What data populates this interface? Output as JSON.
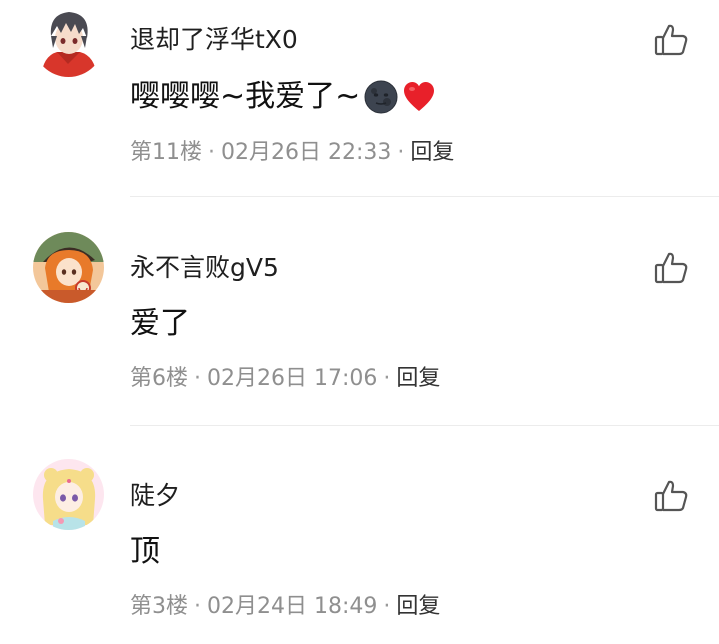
{
  "comments": [
    {
      "username": "退却了浮华tX0",
      "text": "嘤嘤嘤~我爱了~",
      "emojis": [
        "new-moon-face-emoji",
        "red-heart-emoji"
      ],
      "floor": "第11楼",
      "time": "02月26日 22:33",
      "reply_label": "回复",
      "avatar": "anime-boy-red-hoodie"
    },
    {
      "username": "永不言败gV5",
      "text": "爱了",
      "emojis": [],
      "floor": "第6楼",
      "time": "02月26日 17:06",
      "reply_label": "回复",
      "avatar": "anime-girl-orange-halloween"
    },
    {
      "username": "陡夕",
      "text": "顶",
      "emojis": [],
      "floor": "第3楼",
      "time": "02月24日 18:49",
      "reply_label": "回复",
      "avatar": "anime-girl-pastel-blonde"
    }
  ],
  "separator": "·",
  "icons": {
    "like": "thumbs-up-outline-icon"
  },
  "colors": {
    "meta_text": "#8f8f8f",
    "reply_text": "#333333",
    "divider": "#ececec",
    "heart": "#e8202a"
  }
}
